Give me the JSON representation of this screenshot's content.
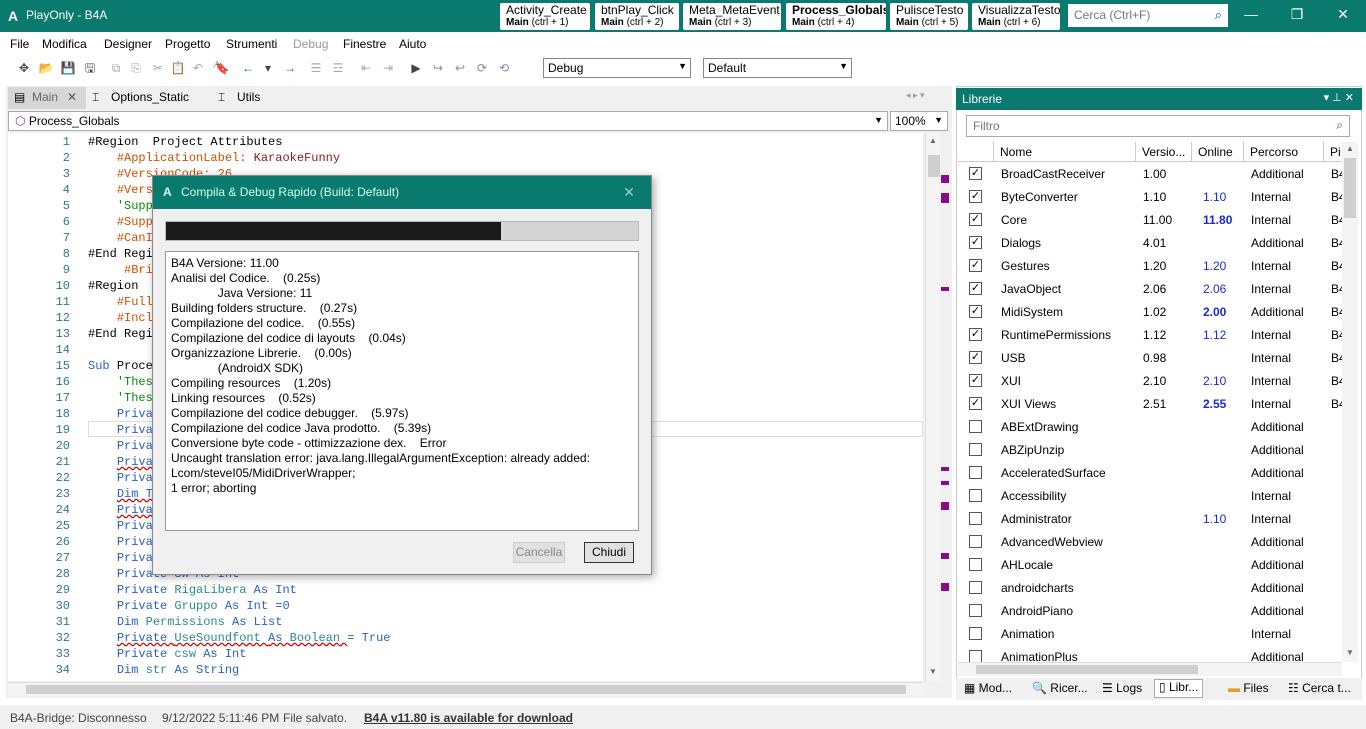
{
  "titlebar": {
    "logo": "A",
    "title": "PlayOnly - B4A",
    "quick_tabs": [
      {
        "title": "Activity_Create",
        "module": "Main",
        "shortcut": "(ctrl + 1)"
      },
      {
        "title": "btnPlay_Click",
        "module": "Main",
        "shortcut": "(ctrl + 2)"
      },
      {
        "title": "Meta_MetaEvent",
        "module": "Main",
        "shortcut": "(ctrl + 3)"
      },
      {
        "title": "Process_Globals",
        "module": "Main",
        "shortcut": "(ctrl + 4)"
      },
      {
        "title": "PulisceTesto",
        "module": "Main",
        "shortcut": "(ctrl + 5)"
      },
      {
        "title": "VisualizzaTesto",
        "module": "Main",
        "shortcut": "(ctrl + 6)"
      }
    ],
    "search_placeholder": "Cerca (Ctrl+F)",
    "search_icon": "search-icon",
    "btn_minimize": "—",
    "btn_maximize": "❐",
    "btn_close": "✕"
  },
  "menu": [
    "File",
    "Modifica",
    "Designer",
    "Progetto",
    "Strumenti",
    "Debug",
    "Finestre",
    "Aiuto"
  ],
  "toolbar": {
    "icons": [
      "✥",
      "📂",
      "💾",
      "🖫",
      "⧉",
      "⎘",
      "✂",
      "📋",
      "↶",
      "↷",
      "🔖",
      "←",
      "▾",
      "→",
      "☰",
      "☲",
      "⇤",
      "⇥",
      "▶",
      "↪",
      "↩",
      "⟳",
      "⟲"
    ],
    "config_combo": "Debug",
    "device_combo": "Default"
  },
  "editor": {
    "tabs": [
      "Main",
      "Options_Static",
      "Utils"
    ],
    "module_combo": "Process_Globals",
    "zoom": "100%",
    "lines": [
      {
        "n": "1",
        "h": [
          [
            "#Region  Project Attributes",
            ""
          ]
        ]
      },
      {
        "n": "2",
        "h": [
          [
            "    ",
            ""
          ],
          [
            "#ApplicationLabel: ",
            "dir"
          ],
          [
            "KaraokeFunny",
            "str"
          ]
        ]
      },
      {
        "n": "3",
        "h": [
          [
            "    ",
            ""
          ],
          [
            "#VersionCode: 26",
            "dir"
          ]
        ]
      },
      {
        "n": "4",
        "h": [
          [
            "    ",
            ""
          ],
          [
            "#Vers",
            "dir"
          ]
        ]
      },
      {
        "n": "5",
        "h": [
          [
            "    ",
            ""
          ],
          [
            "'Supp",
            "cm"
          ]
        ]
      },
      {
        "n": "6",
        "h": [
          [
            "    ",
            ""
          ],
          [
            "#Supp",
            "dir"
          ]
        ]
      },
      {
        "n": "7",
        "h": [
          [
            "    ",
            ""
          ],
          [
            "#CanI",
            "dir"
          ]
        ]
      },
      {
        "n": "8",
        "h": [
          [
            "#End Regi",
            ""
          ]
        ]
      },
      {
        "n": "9",
        "h": [
          [
            "     ",
            ""
          ],
          [
            "#Bri",
            "dir"
          ]
        ]
      },
      {
        "n": "10",
        "h": [
          [
            "#Region",
            ""
          ]
        ]
      },
      {
        "n": "11",
        "h": [
          [
            "    ",
            ""
          ],
          [
            "#Full",
            "dir"
          ]
        ]
      },
      {
        "n": "12",
        "h": [
          [
            "    ",
            ""
          ],
          [
            "#Incl",
            "dir"
          ]
        ]
      },
      {
        "n": "13",
        "h": [
          [
            "#End Regi",
            ""
          ]
        ]
      },
      {
        "n": "14",
        "h": [
          [
            "",
            ""
          ]
        ]
      },
      {
        "n": "15",
        "h": [
          [
            "Sub ",
            "kw"
          ],
          [
            "Proce",
            ""
          ]
        ]
      },
      {
        "n": "16",
        "h": [
          [
            "    ",
            ""
          ],
          [
            "'Thes",
            "cm"
          ]
        ]
      },
      {
        "n": "17",
        "h": [
          [
            "    ",
            ""
          ],
          [
            "'Thes",
            "cm"
          ]
        ]
      },
      {
        "n": "18",
        "h": [
          [
            "    ",
            ""
          ],
          [
            "Priva",
            "kw"
          ]
        ]
      },
      {
        "n": "19",
        "h": [
          [
            "    ",
            ""
          ],
          [
            "Priva",
            "kw"
          ]
        ]
      },
      {
        "n": "20",
        "h": [
          [
            "    ",
            ""
          ],
          [
            "Priva",
            "kw"
          ]
        ]
      },
      {
        "n": "21",
        "h": [
          [
            "    ",
            ""
          ],
          [
            "Priva",
            "kw ul"
          ]
        ]
      },
      {
        "n": "22",
        "h": [
          [
            "    ",
            ""
          ],
          [
            "Priva",
            "kw"
          ]
        ]
      },
      {
        "n": "23",
        "h": [
          [
            "    ",
            ""
          ],
          [
            "Dim T",
            "kw ul"
          ]
        ]
      },
      {
        "n": "24",
        "h": [
          [
            "    ",
            ""
          ],
          [
            "Priva",
            "kw ul"
          ]
        ]
      },
      {
        "n": "25",
        "h": [
          [
            "    ",
            ""
          ],
          [
            "Priva",
            "kw"
          ]
        ]
      },
      {
        "n": "26",
        "h": [
          [
            "    ",
            ""
          ],
          [
            "Priva",
            "kw"
          ]
        ]
      },
      {
        "n": "27",
        "h": [
          [
            "    ",
            ""
          ],
          [
            "Priva",
            "kw"
          ]
        ]
      },
      {
        "n": "28",
        "h": [
          [
            "    ",
            ""
          ],
          [
            "Private Sw As Int",
            "kw"
          ]
        ]
      },
      {
        "n": "29",
        "h": [
          [
            "    ",
            ""
          ],
          [
            "Private ",
            "kw"
          ],
          [
            "RigaLibera ",
            "typ"
          ],
          [
            "As Int",
            "kw"
          ]
        ]
      },
      {
        "n": "30",
        "h": [
          [
            "    ",
            ""
          ],
          [
            "Private ",
            "kw"
          ],
          [
            "Gruppo ",
            "typ"
          ],
          [
            "As Int =0",
            "kw"
          ]
        ]
      },
      {
        "n": "31",
        "h": [
          [
            "    ",
            ""
          ],
          [
            "Dim ",
            "kw"
          ],
          [
            "Permissions ",
            "typ"
          ],
          [
            "As List",
            "kw"
          ]
        ]
      },
      {
        "n": "32",
        "h": [
          [
            "    ",
            ""
          ],
          [
            "Private ",
            "kw ul"
          ],
          [
            "UseSoundfont ",
            "typ ul"
          ],
          [
            "As ",
            "kw ul"
          ],
          [
            "Boolean ",
            "typ ul"
          ],
          [
            "= True",
            "kw"
          ]
        ]
      },
      {
        "n": "33",
        "h": [
          [
            "    ",
            ""
          ],
          [
            "Private ",
            "kw"
          ],
          [
            "csw ",
            "typ"
          ],
          [
            "As Int",
            "kw"
          ]
        ]
      },
      {
        "n": "34",
        "h": [
          [
            "    ",
            ""
          ],
          [
            "Dim ",
            "kw"
          ],
          [
            "str ",
            "typ"
          ],
          [
            "As String",
            "kw"
          ]
        ]
      }
    ]
  },
  "dialog": {
    "logo": "A",
    "title": "Compila & Debug Rapido (Build: Default)",
    "close": "✕",
    "progress": 0.71,
    "log": [
      "B4A Versione: 11.00",
      "Analisi del Codice.    (0.25s)",
      "              Java Versione: 11",
      "Building folders structure.    (0.27s)",
      "Compilazione del codice.    (0.55s)",
      "Compilazione del codice di layouts    (0.04s)",
      "Organizzazione Librerie.    (0.00s)",
      "              (AndroidX SDK)",
      "Compiling resources    (1.20s)",
      "Linking resources    (0.52s)",
      "Compilazione del codice debugger.    (5.97s)",
      "Compilazione del codice Java prodotto.    (5.39s)",
      "Conversione byte code - ottimizzazione dex.    Error",
      "Uncaught translation error: java.lang.IllegalArgumentException: already added: Lcom/steveI05/MidiDriverWrapper;",
      "1 error; aborting"
    ],
    "btn_cancel": "Cancella",
    "btn_close": "Chiudi"
  },
  "libraries": {
    "panel_title": "Librerie",
    "filter_placeholder": "Filtro",
    "columns": [
      "Nome",
      "Versio...",
      "Online",
      "Percorso",
      "Pi"
    ],
    "rows": [
      {
        "checked": true,
        "name": "BroadCastReceiver",
        "version": "1.00",
        "online": "",
        "online_bold": false,
        "path": "Additional",
        "p": "B4"
      },
      {
        "checked": true,
        "name": "ByteConverter",
        "version": "1.10",
        "online": "1.10",
        "online_bold": false,
        "path": "Internal",
        "p": "B4"
      },
      {
        "checked": true,
        "name": "Core",
        "version": "11.00",
        "online": "11.80",
        "online_bold": true,
        "path": "Internal",
        "p": "B4"
      },
      {
        "checked": true,
        "name": "Dialogs",
        "version": "4.01",
        "online": "",
        "online_bold": false,
        "path": "Additional",
        "p": "B4"
      },
      {
        "checked": true,
        "name": "Gestures",
        "version": "1.20",
        "online": "1.20",
        "online_bold": false,
        "path": "Internal",
        "p": "B4"
      },
      {
        "checked": true,
        "name": "JavaObject",
        "version": "2.06",
        "online": "2.06",
        "online_bold": false,
        "path": "Internal",
        "p": "B4"
      },
      {
        "checked": true,
        "name": "MidiSystem",
        "version": "1.02",
        "online": "2.00",
        "online_bold": true,
        "path": "Additional",
        "p": "B4"
      },
      {
        "checked": true,
        "name": "RuntimePermissions",
        "version": "1.12",
        "online": "1.12",
        "online_bold": false,
        "path": "Internal",
        "p": "B4"
      },
      {
        "checked": true,
        "name": "USB",
        "version": "0.98",
        "online": "",
        "online_bold": false,
        "path": "Internal",
        "p": "B4"
      },
      {
        "checked": true,
        "name": "XUI",
        "version": "2.10",
        "online": "2.10",
        "online_bold": false,
        "path": "Internal",
        "p": "B4"
      },
      {
        "checked": true,
        "name": "XUI Views",
        "version": "2.51",
        "online": "2.55",
        "online_bold": true,
        "path": "Internal",
        "p": "B4"
      },
      {
        "checked": false,
        "name": "ABExtDrawing",
        "version": "",
        "online": "",
        "online_bold": false,
        "path": "Additional",
        "p": ""
      },
      {
        "checked": false,
        "name": "ABZipUnzip",
        "version": "",
        "online": "",
        "online_bold": false,
        "path": "Additional",
        "p": ""
      },
      {
        "checked": false,
        "name": "AcceleratedSurface",
        "version": "",
        "online": "",
        "online_bold": false,
        "path": "Additional",
        "p": ""
      },
      {
        "checked": false,
        "name": "Accessibility",
        "version": "",
        "online": "",
        "online_bold": false,
        "path": "Internal",
        "p": ""
      },
      {
        "checked": false,
        "name": "Administrator",
        "version": "",
        "online": "1.10",
        "online_bold": false,
        "path": "Internal",
        "p": ""
      },
      {
        "checked": false,
        "name": "AdvancedWebview",
        "version": "",
        "online": "",
        "online_bold": false,
        "path": "Additional",
        "p": ""
      },
      {
        "checked": false,
        "name": "AHLocale",
        "version": "",
        "online": "",
        "online_bold": false,
        "path": "Additional",
        "p": ""
      },
      {
        "checked": false,
        "name": "androidcharts",
        "version": "",
        "online": "",
        "online_bold": false,
        "path": "Additional",
        "p": ""
      },
      {
        "checked": false,
        "name": "AndroidPiano",
        "version": "",
        "online": "",
        "online_bold": false,
        "path": "Additional",
        "p": ""
      },
      {
        "checked": false,
        "name": "Animation",
        "version": "",
        "online": "",
        "online_bold": false,
        "path": "Internal",
        "p": ""
      },
      {
        "checked": false,
        "name": "AnimationPlus",
        "version": "",
        "online": "",
        "online_bold": false,
        "path": "Additional",
        "p": ""
      }
    ],
    "tabs": [
      "Mod...",
      "Ricer...",
      "Logs",
      "Libr...",
      "Files",
      "Cerca t..."
    ]
  },
  "status": {
    "bridge": "B4A-Bridge: Disconnesso",
    "datetime": "9/12/2022 5:11:46 PM",
    "saved": "File salvato.",
    "update": "B4A v11.80 is available for download"
  },
  "colors": {
    "accent": "#0a7a6e",
    "link": "#1a2ad0"
  }
}
